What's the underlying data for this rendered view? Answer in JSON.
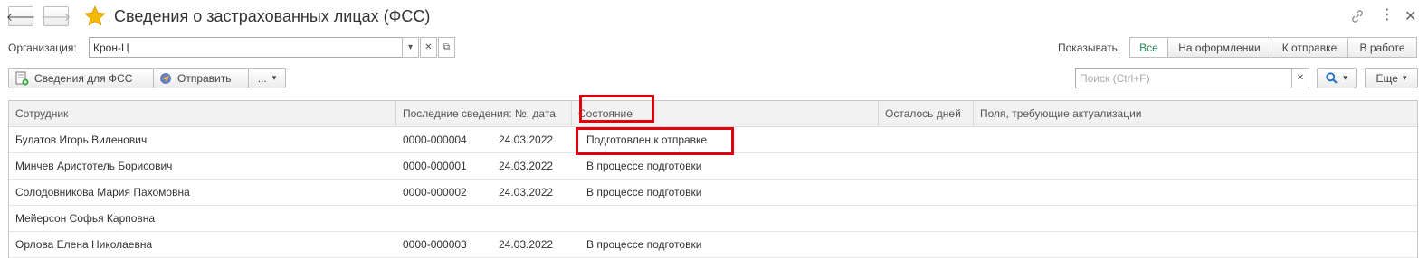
{
  "window": {
    "title": "Сведения о застрахованных лицах (ФСС)"
  },
  "org": {
    "label": "Организация:",
    "value": "Крон-Ц"
  },
  "filter": {
    "label": "Показывать:",
    "options": [
      "Все",
      "На оформлении",
      "К отправке",
      "В работе"
    ],
    "active": "Все"
  },
  "toolbar": {
    "fss_button": "Сведения для ФСС",
    "send_button": "Отправить",
    "more_button": "...",
    "search_placeholder": "Поиск (Ctrl+F)",
    "more_menu": "Еще"
  },
  "table": {
    "columns": [
      "Сотрудник",
      "Последние сведения: №, дата",
      "Состояние",
      "Осталось дней",
      "Поля, требующие актуализации"
    ],
    "rows": [
      {
        "employee": "Булатов Игорь Виленович",
        "number": "0000-000004",
        "date": "24.03.2022",
        "state": "Подготовлен к отправке",
        "days": "",
        "fields": ""
      },
      {
        "employee": "Минчев Аристотель Борисович",
        "number": "0000-000001",
        "date": "24.03.2022",
        "state": "В процессе подготовки",
        "days": "",
        "fields": ""
      },
      {
        "employee": "Солодовникова Мария Пахомовна",
        "number": "0000-000002",
        "date": "24.03.2022",
        "state": "В процессе подготовки",
        "days": "",
        "fields": ""
      },
      {
        "employee": "Мейерсон Софья Карповна",
        "number": "",
        "date": "",
        "state": "",
        "days": "",
        "fields": ""
      },
      {
        "employee": "Орлова Елена Николаевна",
        "number": "0000-000003",
        "date": "24.03.2022",
        "state": "В процессе подготовки",
        "days": "",
        "fields": ""
      }
    ]
  },
  "colors": {
    "highlight": "#e3000f",
    "active_filter": "#2e8b57",
    "star": "#f5b800"
  }
}
